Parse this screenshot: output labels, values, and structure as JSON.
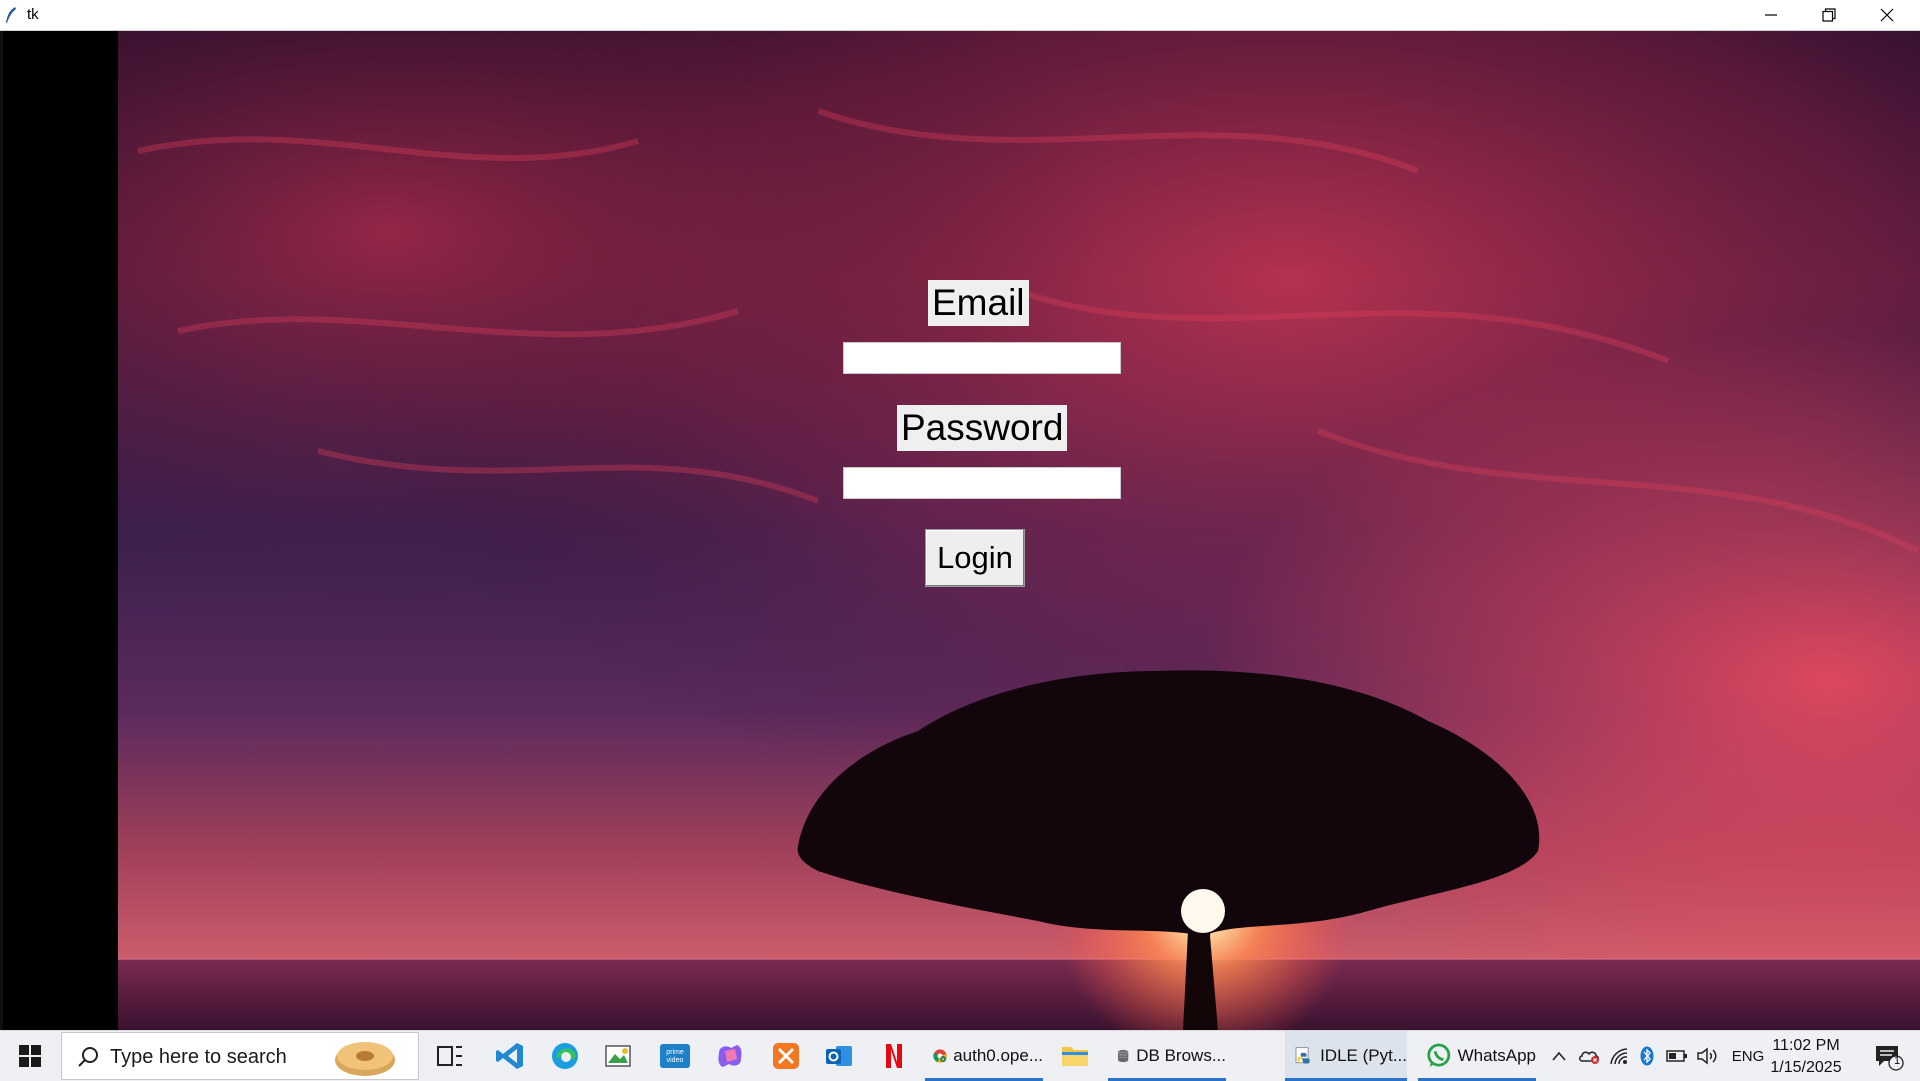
{
  "window": {
    "title": "tk"
  },
  "form": {
    "email_label": "Email",
    "email_value": "",
    "password_label": "Password",
    "password_value": "",
    "login_label": "Login"
  },
  "taskbar": {
    "search_placeholder": "Type here to search",
    "apps": [
      {
        "label": "auth0.ope..."
      },
      {
        "label": "DB Brows..."
      },
      {
        "label": "IDLE (Pyt..."
      },
      {
        "label": "WhatsApp"
      }
    ],
    "tray": {
      "language": "ENG",
      "time": "11:02 PM",
      "date": "1/15/2025",
      "notification_count": "1"
    }
  }
}
